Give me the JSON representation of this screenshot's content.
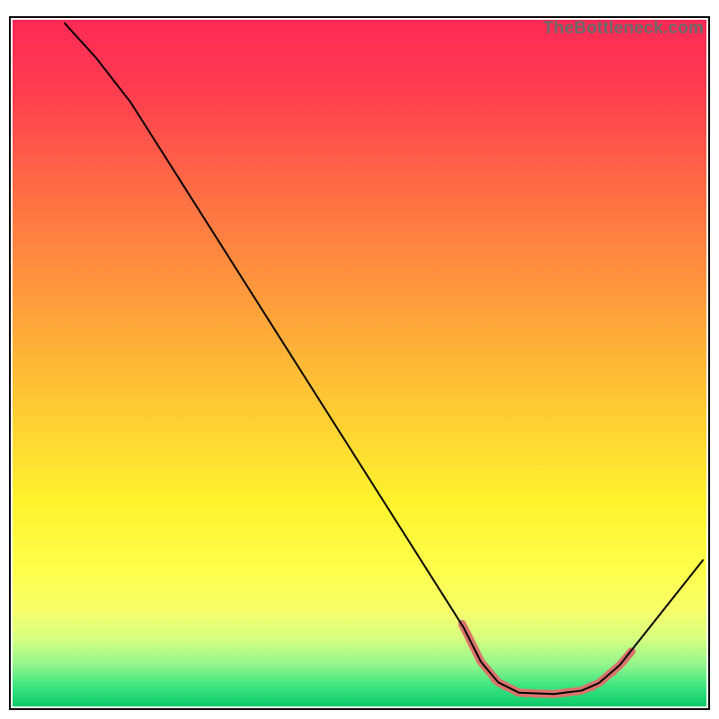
{
  "watermark": "TheBottleneck.com",
  "chart_data": {
    "type": "line",
    "title": "",
    "xlabel": "",
    "ylabel": "",
    "xlim": [
      0,
      100
    ],
    "ylim": [
      0,
      100
    ],
    "curve": {
      "name": "bottleneck-curve",
      "color": "#000000",
      "points": [
        {
          "x": 7.5,
          "y": 99.5
        },
        {
          "x": 12.0,
          "y": 94.5
        },
        {
          "x": 17.0,
          "y": 88.0
        },
        {
          "x": 65.0,
          "y": 11.5
        },
        {
          "x": 67.5,
          "y": 6.5
        },
        {
          "x": 70.0,
          "y": 3.5
        },
        {
          "x": 73.0,
          "y": 2.0
        },
        {
          "x": 78.0,
          "y": 1.8
        },
        {
          "x": 82.0,
          "y": 2.3
        },
        {
          "x": 84.5,
          "y": 3.4
        },
        {
          "x": 87.5,
          "y": 6.0
        },
        {
          "x": 99.5,
          "y": 21.3
        }
      ]
    },
    "marker_segment": {
      "color": "#d9736b",
      "width": 9,
      "points": [
        {
          "x": 64.8,
          "y": 12.0
        },
        {
          "x": 67.5,
          "y": 6.5
        },
        {
          "x": 70.0,
          "y": 3.5
        },
        {
          "x": 73.0,
          "y": 2.0
        },
        {
          "x": 78.0,
          "y": 1.8
        },
        {
          "x": 82.0,
          "y": 2.3
        },
        {
          "x": 84.5,
          "y": 3.4
        },
        {
          "x": 87.5,
          "y": 6.0
        },
        {
          "x": 89.2,
          "y": 8.0
        }
      ]
    },
    "marker_dots": {
      "color": "#d9736b",
      "radius": 4.5,
      "points": [
        {
          "x": 69.5,
          "y": 3.9
        },
        {
          "x": 71.0,
          "y": 2.9
        },
        {
          "x": 72.5,
          "y": 2.2
        },
        {
          "x": 74.0,
          "y": 1.9
        },
        {
          "x": 75.5,
          "y": 1.8
        },
        {
          "x": 77.0,
          "y": 1.8
        },
        {
          "x": 78.5,
          "y": 1.9
        },
        {
          "x": 80.0,
          "y": 2.0
        },
        {
          "x": 81.5,
          "y": 2.2
        },
        {
          "x": 83.5,
          "y": 2.8
        },
        {
          "x": 85.0,
          "y": 3.8
        },
        {
          "x": 86.5,
          "y": 5.0
        },
        {
          "x": 88.0,
          "y": 6.5
        }
      ]
    },
    "gradient_stops": [
      {
        "offset": 0.0,
        "color": "#ff2a55"
      },
      {
        "offset": 0.1,
        "color": "#ff3c50"
      },
      {
        "offset": 0.25,
        "color": "#ff6d45"
      },
      {
        "offset": 0.4,
        "color": "#ff9a3c"
      },
      {
        "offset": 0.55,
        "color": "#ffc634"
      },
      {
        "offset": 0.7,
        "color": "#fff22d"
      },
      {
        "offset": 0.8,
        "color": "#ffff4a"
      },
      {
        "offset": 0.86,
        "color": "#f7ff6a"
      },
      {
        "offset": 0.9,
        "color": "#d8ff80"
      },
      {
        "offset": 0.94,
        "color": "#90f58c"
      },
      {
        "offset": 0.97,
        "color": "#3de680"
      },
      {
        "offset": 1.0,
        "color": "#0cc96a"
      }
    ]
  }
}
